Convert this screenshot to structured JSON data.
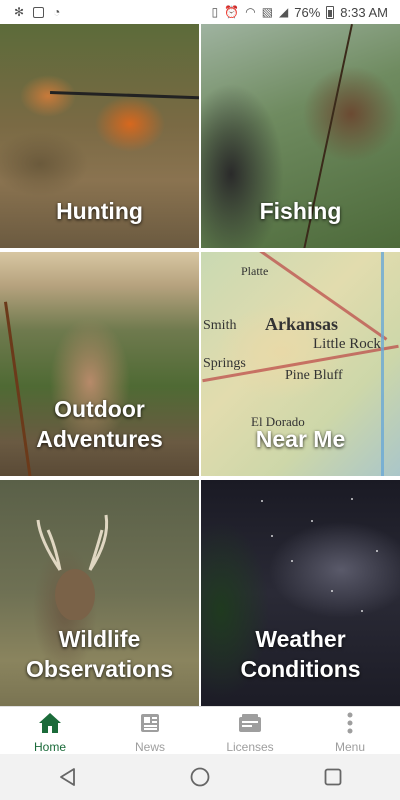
{
  "status_bar": {
    "battery_percent": "76%",
    "time": "8:33 AM",
    "left_icons": [
      "slack-icon",
      "image-icon",
      "data-saver-icon"
    ],
    "right_icons": [
      "vibrate-icon",
      "alarm-icon",
      "wifi-icon",
      "no-sim-icon",
      "signal-icon",
      "battery-icon"
    ]
  },
  "tiles": [
    {
      "id": "hunting",
      "label": "Hunting"
    },
    {
      "id": "fishing",
      "label": "Fishing"
    },
    {
      "id": "outdoor-adventures",
      "label": "Outdoor\nAdventures"
    },
    {
      "id": "near-me",
      "label": "Near Me"
    },
    {
      "id": "wildlife-observations",
      "label": "Wildlife\nObservations"
    },
    {
      "id": "weather-conditions",
      "label": "Weather\nConditions"
    }
  ],
  "map_text": [
    "Arkansas",
    "Little Rock",
    "Pine Bluff",
    "Springs",
    "Smith",
    "El Dorado",
    "Platte"
  ],
  "bottom_nav": {
    "items": [
      {
        "label": "Home",
        "icon": "home-icon",
        "active": true
      },
      {
        "label": "News",
        "icon": "news-icon",
        "active": false
      },
      {
        "label": "Licenses",
        "icon": "licenses-icon",
        "active": false
      },
      {
        "label": "Menu",
        "icon": "more-vert-icon",
        "active": false
      }
    ]
  },
  "colors": {
    "accent": "#1b6b3a",
    "inactive": "#9e9e9e"
  }
}
